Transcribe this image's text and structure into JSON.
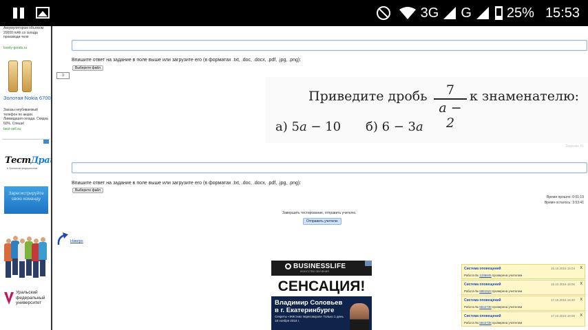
{
  "status_bar": {
    "network_3g": "3G",
    "network_g": "G",
    "battery": "25%",
    "time": "15:53"
  },
  "left_ads": {
    "powerbank_text": "Аккумулятором объемом 20000 mAh со склада производи-теля",
    "powerbank_link": "lovely-goods.ru",
    "nokia_title": "Золотая Nokia 6700",
    "nokia_text": "Заказы неубиваемый телефон по акции. Ликвидация склада. Скидка 60%. Спеши!",
    "nokia_link": "best-sell.su",
    "testdrive_brand_a": "Тест",
    "testdrive_brand_b": "Драйв",
    "testdrive_sub": "в Уральском федеральном",
    "register_text": "Зарегистрируйте свою команду",
    "urfu_text": "Уральский федеральный университет"
  },
  "task_block_1": {
    "instruction": "Впишите ответ на задание в поле выше или загрузите его (в форматах .txt, .doc, .docx, .pdf, .jpg, .png):",
    "file_button": "Выберите файл"
  },
  "question_number": "3",
  "task_image": {
    "lead_text": "Приведите дробь",
    "fraction_num": "7",
    "fraction_den": "a − 2",
    "tail_text": "к знаменателю:",
    "option_a": "а) 5",
    "option_a_var": "a",
    "option_a_rest": " − 10",
    "option_b": "б) 6 − 3",
    "option_b_var": "a"
  },
  "task_label": "Задание 21",
  "task_block_2": {
    "instruction": "Впишите ответ на задание в поле выше или загрузите его (в форматах .txt, .doc, .docx, .pdf, .jpg, .png):",
    "file_button": "Выберите файл"
  },
  "timer": {
    "elapsed": "Время прошло: 0:01:19",
    "remaining": "Время осталось: 3:53:41"
  },
  "finish_note": "Завершить тестирование, отправить учителю.",
  "send_button": "Отправить учителю",
  "back_link": "Наверх",
  "business_ad": {
    "brand": "BUSINESSLIFE",
    "sub": "ИСКУССТВО ОБУЧЕНИЯ",
    "headline": "СЕНСАЦИЯ!",
    "name": "Владимир Соловьев в г. Екатеринбурге",
    "small": "Секреты «Жёстких переговоров» Только 1 день 18 ноября 2016 г."
  },
  "notifications": [
    {
      "title": "Система оповещений",
      "date": "16.10.2016 15:04",
      "body_a": "Работа №",
      "num": "1236845",
      "body_b": "проверена учителем"
    },
    {
      "title": "Система оповещений",
      "date": "16.10.2016 18:00",
      "body_a": "Работа №",
      "num": "5861523",
      "body_b": "проверена учителем"
    },
    {
      "title": "Система оповещений",
      "date": "17.10.2016 15:40",
      "body_a": "Работа №",
      "num": "5842738",
      "body_b": "проверена учителем"
    },
    {
      "title": "Система оповещений",
      "date": "17.10.2016 18:00",
      "body_a": "Работа №",
      "num": "5842738",
      "body_b": "проверена учителем"
    }
  ]
}
